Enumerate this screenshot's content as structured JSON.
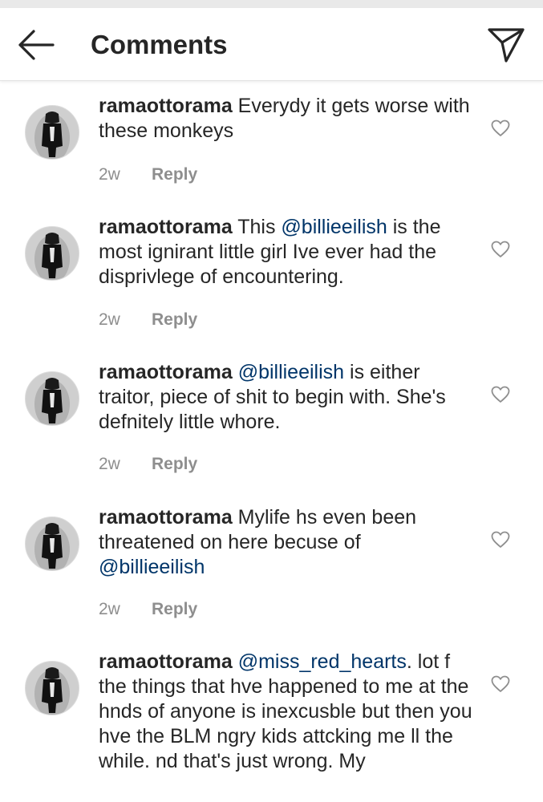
{
  "header": {
    "title": "Comments",
    "back_icon": "arrow-left-icon",
    "share_icon": "direct-send-icon"
  },
  "comments": [
    {
      "username": "ramaottorama",
      "segments": [
        {
          "text": " Everydy it gets worse with these monkeys",
          "type": "text"
        }
      ],
      "time": "2w",
      "reply_label": "Reply"
    },
    {
      "username": "ramaottorama",
      "segments": [
        {
          "text": " This ",
          "type": "text"
        },
        {
          "text": "@billieeilish",
          "type": "mention"
        },
        {
          "text": " is the most ignirant little girl Ive ever had the disprivlege of encountering.",
          "type": "text"
        }
      ],
      "time": "2w",
      "reply_label": "Reply"
    },
    {
      "username": "ramaottorama",
      "segments": [
        {
          "text": " ",
          "type": "text"
        },
        {
          "text": "@billieeilish",
          "type": "mention"
        },
        {
          "text": " is either traitor,  piece of shit to begin with. She's defnitely  little whore.",
          "type": "text"
        }
      ],
      "time": "2w",
      "reply_label": "Reply"
    },
    {
      "username": "ramaottorama",
      "segments": [
        {
          "text": " Mylife hs even been threatened on here becuse of ",
          "type": "text"
        },
        {
          "text": "@billieeilish",
          "type": "mention"
        }
      ],
      "time": "2w",
      "reply_label": "Reply"
    },
    {
      "username": "ramaottorama",
      "segments": [
        {
          "text": " ",
          "type": "text"
        },
        {
          "text": "@miss_red_hearts",
          "type": "mention"
        },
        {
          "text": ".  lot f the things that hve happened to me at the hnds of anyone is inexcusble but then you hve the BLM ngry kids attcking me ll the while. nd that's just wrong. My",
          "type": "text"
        }
      ],
      "time": "",
      "reply_label": ""
    }
  ]
}
